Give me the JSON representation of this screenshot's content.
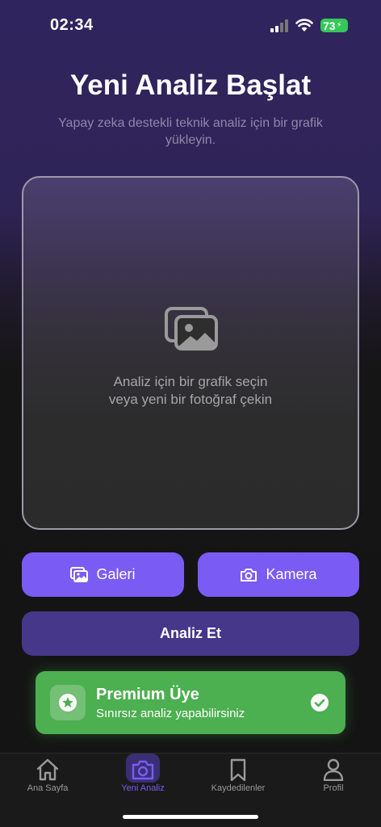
{
  "status": {
    "time": "02:34",
    "battery": "73"
  },
  "header": {
    "title": "Yeni Analiz Başlat",
    "subtitle": "Yapay zeka destekli teknik analiz için bir grafik yükleyin."
  },
  "upload": {
    "icon": "images-icon",
    "line1": "Analiz için bir grafik seçin",
    "line2": "veya yeni bir fotoğraf çekin"
  },
  "actions": {
    "gallery_label": "Galeri",
    "camera_label": "Kamera",
    "analyze_label": "Analiz Et"
  },
  "premium": {
    "title": "Premium Üye",
    "subtitle": "Sınırsız analiz yapabilirsiniz"
  },
  "tabs": [
    {
      "label": "Ana Sayfa",
      "icon": "home-icon"
    },
    {
      "label": "Yeni Analiz",
      "icon": "camera-icon",
      "active": true
    },
    {
      "label": "Kaydedilenler",
      "icon": "bookmark-icon"
    },
    {
      "label": "Profil",
      "icon": "person-icon"
    }
  ],
  "colors": {
    "accent": "#7a5cf4",
    "analyze_button": "#46378a",
    "premium_green": "#4caf50",
    "battery_green": "#35c759"
  }
}
